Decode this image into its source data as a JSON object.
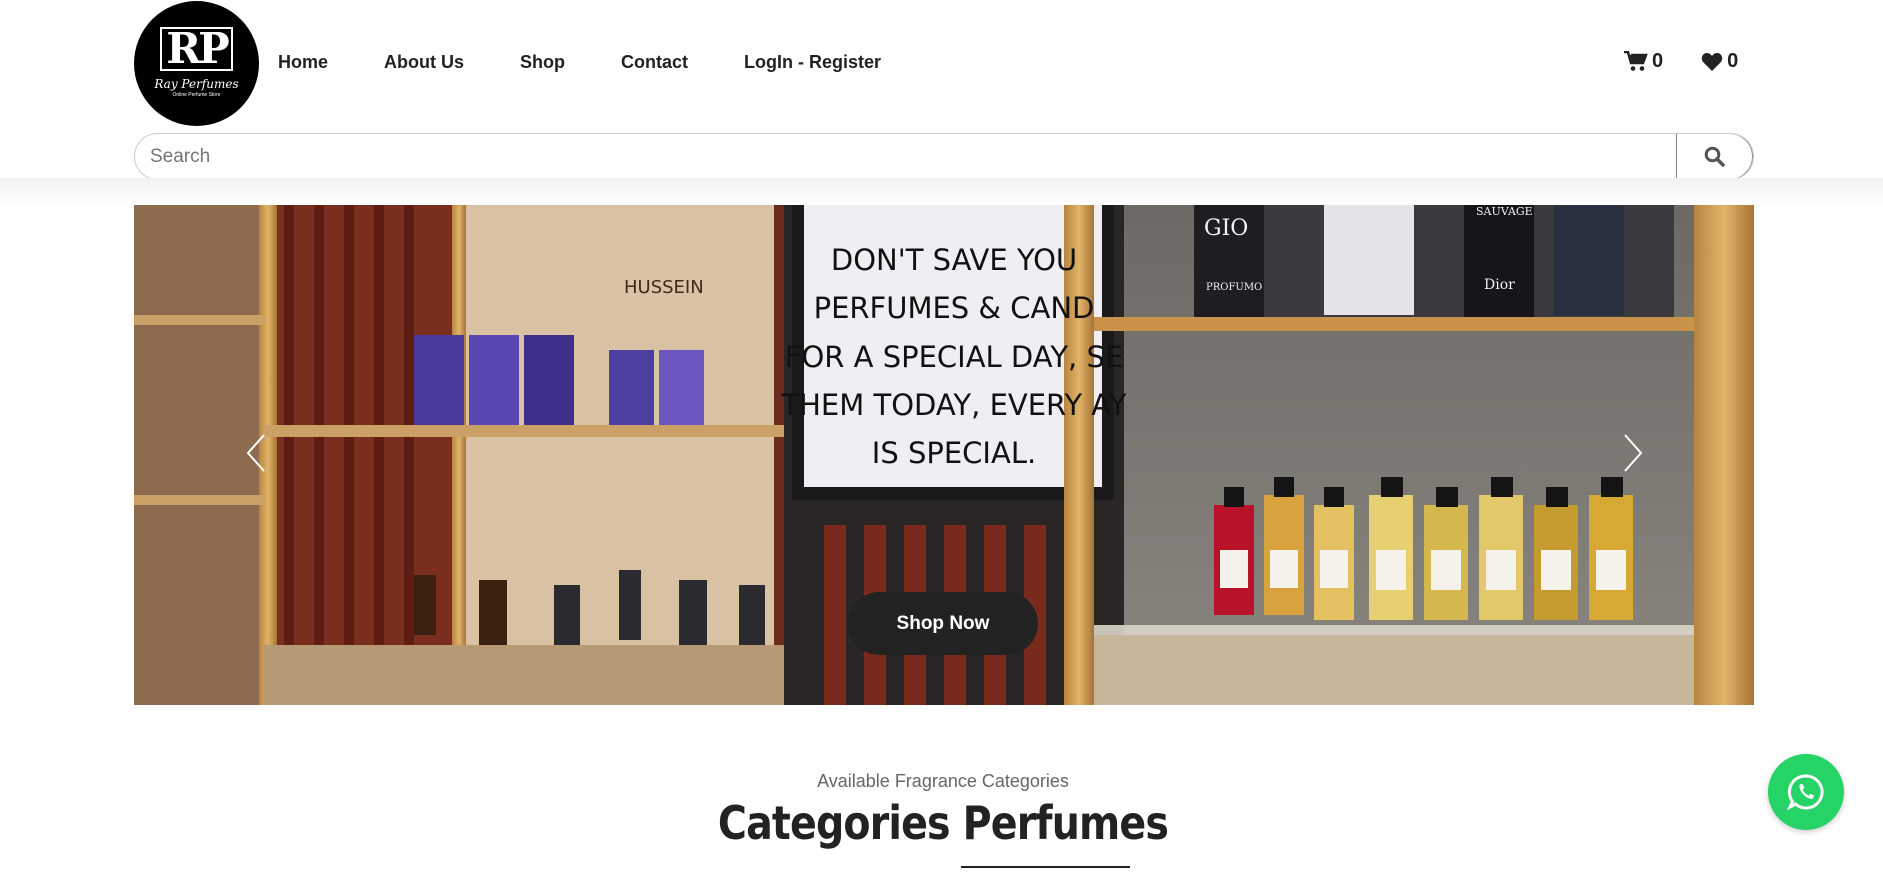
{
  "brand": {
    "logo_mark": "RP",
    "name": "Ray Perfumes",
    "tagline": "Online Perfume Store"
  },
  "nav": [
    {
      "label": "Home"
    },
    {
      "label": "About Us"
    },
    {
      "label": "Shop"
    },
    {
      "label": "Contact"
    },
    {
      "label": "LogIn - Register"
    }
  ],
  "counters": {
    "cart_count": "0",
    "wishlist_count": "0",
    "cart_icon": "cart-icon",
    "wishlist_icon": "heart-icon"
  },
  "search": {
    "placeholder": "Search",
    "button_icon": "search-icon"
  },
  "hero": {
    "sign_text": [
      "DON'T SAVE YOU",
      "PERFUMES & CAND",
      "FOR A SPECIAL DAY, SE",
      "THEM TODAY, EVERY  AY",
      "IS SPECIAL."
    ],
    "shelf_labels": [
      "GIO",
      "PROFUMO",
      "SAUVAGE",
      "Dior",
      "HUSSEIN"
    ],
    "cta": "Shop Now"
  },
  "categories": {
    "kicker": "Available Fragrance Categories",
    "title": "Categories Perfumes"
  },
  "colors": {
    "accent_dark": "#222222",
    "whatsapp": "#25d366"
  }
}
